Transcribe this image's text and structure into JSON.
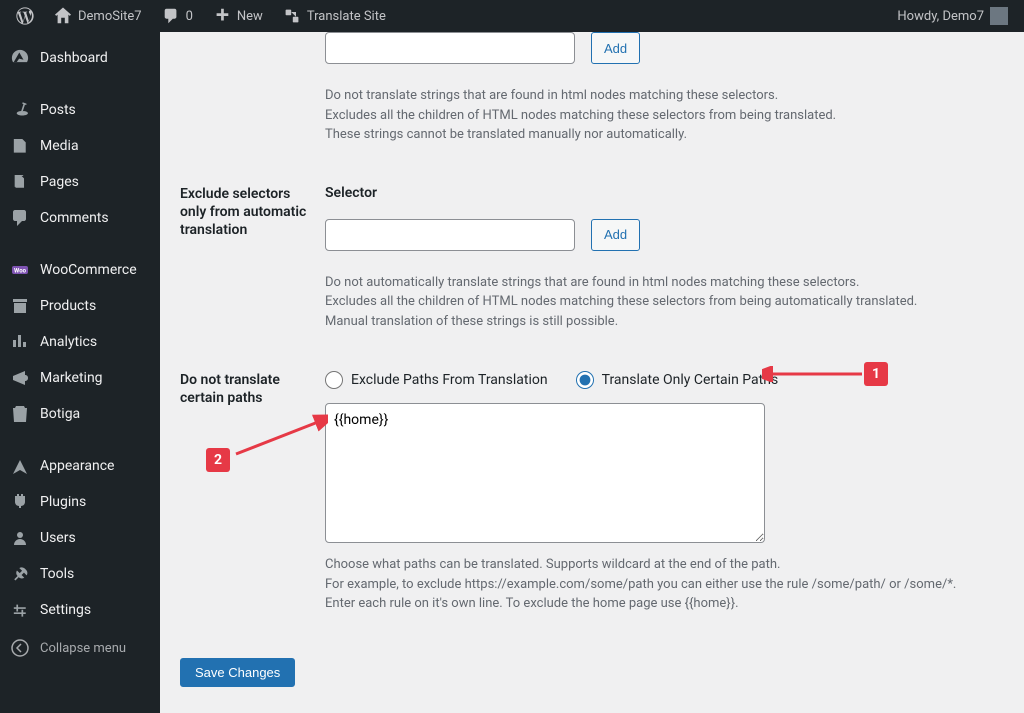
{
  "adminbar": {
    "site_name": "DemoSite7",
    "comments_count": "0",
    "new_label": "New",
    "translate_label": "Translate Site",
    "howdy": "Howdy, Demo7"
  },
  "sidebar": {
    "items": [
      {
        "label": "Dashboard"
      },
      {
        "sep": true
      },
      {
        "label": "Posts"
      },
      {
        "label": "Media"
      },
      {
        "label": "Pages"
      },
      {
        "label": "Comments"
      },
      {
        "sep": true
      },
      {
        "label": "WooCommerce"
      },
      {
        "label": "Products"
      },
      {
        "label": "Analytics"
      },
      {
        "label": "Marketing"
      },
      {
        "label": "Botiga"
      },
      {
        "sep": true
      },
      {
        "label": "Appearance"
      },
      {
        "label": "Plugins"
      },
      {
        "label": "Users"
      },
      {
        "label": "Tools"
      },
      {
        "label": "Settings"
      }
    ],
    "collapse_label": "Collapse menu"
  },
  "form": {
    "section1": {
      "help1": "Do not translate strings that are found in html nodes matching these selectors.",
      "help2": "Excludes all the children of HTML nodes matching these selectors from being translated.",
      "help3": "These strings cannot be translated manually nor automatically.",
      "add": "Add"
    },
    "section2": {
      "label": "Exclude selectors only from automatic translation",
      "selector_label": "Selector",
      "add": "Add",
      "help1": "Do not automatically translate strings that are found in html nodes matching these selectors.",
      "help2": "Excludes all the children of HTML nodes matching these selectors from being automatically translated.",
      "help3": "Manual translation of these strings is still possible."
    },
    "section3": {
      "label": "Do not translate certain paths",
      "radio1": "Exclude Paths From Translation",
      "radio2": "Translate Only Certain Paths",
      "textarea_value": "{{home}}",
      "help1": "Choose what paths can be translated. Supports wildcard at the end of the path.",
      "help2": "For example, to exclude https://example.com/some/path you can either use the rule /some/path/ or /some/*.",
      "help3": "Enter each rule on it's own line. To exclude the home page use {{home}}."
    },
    "save_label": "Save Changes"
  },
  "annotations": {
    "n1": "1",
    "n2": "2"
  }
}
